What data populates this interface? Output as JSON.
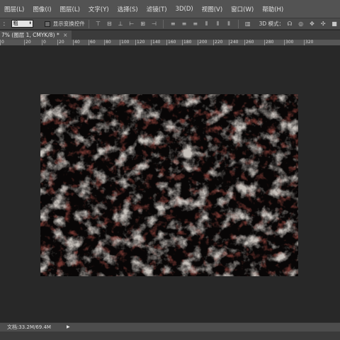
{
  "menu": [
    "图层(L)",
    "图像(I)",
    "图层(L)",
    "文字(Y)",
    "选择(S)",
    "滤镜(T)",
    "3D(D)",
    "视图(V)",
    "窗口(W)",
    "帮助(H)"
  ],
  "options": {
    "size_label": "：",
    "size_value": "粗",
    "show_transform_label": "显示变换控件",
    "mode_label": "3D 模式："
  },
  "document_tab": {
    "title": "7% (图层 1, CMYK/8) *"
  },
  "ruler": {
    "ticks": [
      "0",
      "20",
      "0",
      "20",
      "40",
      "60",
      "80",
      "100",
      "120",
      "140",
      "160",
      "180",
      "200",
      "220",
      "240",
      "260",
      "280",
      "300",
      "320"
    ]
  },
  "status": {
    "doc_info": "文档:33.2M/69.4M",
    "arrow": "▶"
  },
  "colors": {
    "menubar": "#535353",
    "workspace": "#282828",
    "canvas_base": "#080606",
    "noise_light": "#d8d2cc",
    "noise_red": "#7a3a34"
  }
}
